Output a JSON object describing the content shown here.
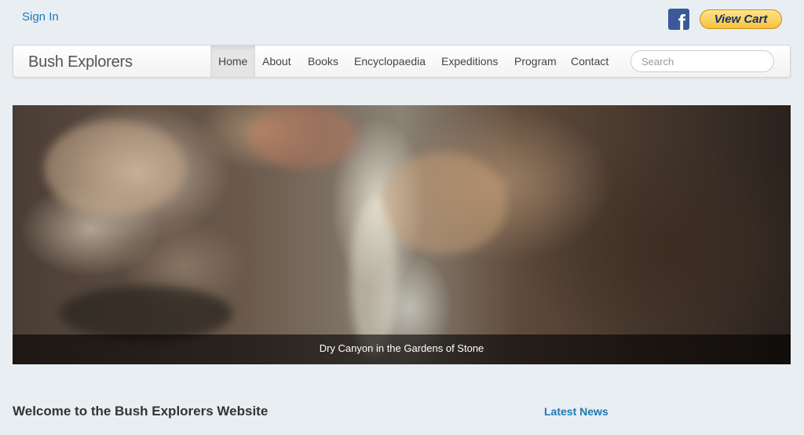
{
  "topbar": {
    "signin_label": "Sign In",
    "facebook_icon": "facebook-icon",
    "view_cart_label": "View Cart"
  },
  "navbar": {
    "brand": "Bush Explorers",
    "items": [
      {
        "label": "Home",
        "active": true
      },
      {
        "label": "About"
      },
      {
        "label": "Books"
      },
      {
        "label": "Encyclopaedia"
      },
      {
        "label": "Expeditions"
      },
      {
        "label": "Program"
      },
      {
        "label": "Contact"
      }
    ],
    "search_placeholder": "Search"
  },
  "hero": {
    "caption": "Dry Canyon in the Gardens of Stone"
  },
  "main": {
    "welcome_heading": "Welcome to the Bush Explorers Website",
    "latest_news_heading": "Latest News"
  },
  "colors": {
    "link": "#1f78b4",
    "facebook": "#3b5998",
    "cart_button": "#f7c13a"
  }
}
